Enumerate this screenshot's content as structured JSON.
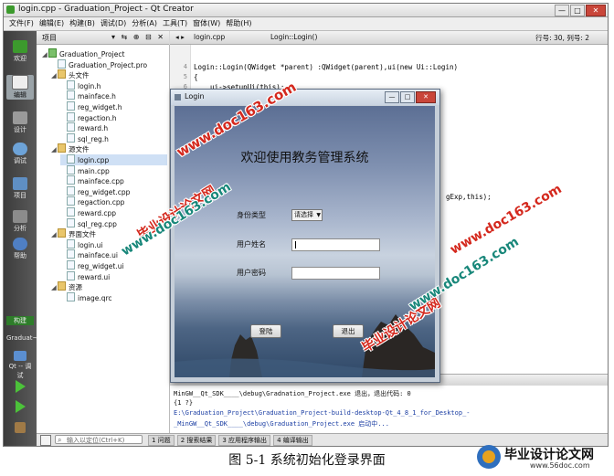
{
  "window": {
    "title": "login.cpp - Graduation_Project - Qt Creator",
    "buttons": [
      "—",
      "□",
      "✕"
    ]
  },
  "menu": [
    "文件(F)",
    "编辑(E)",
    "构建(B)",
    "调试(D)",
    "分析(A)",
    "工具(T)",
    "窗体(W)",
    "帮助(H)"
  ],
  "modes": [
    {
      "label": "欢迎"
    },
    {
      "label": "编辑"
    },
    {
      "label": "设计"
    },
    {
      "label": "调试"
    },
    {
      "label": "项目"
    },
    {
      "label": "分析"
    },
    {
      "label": "帮助"
    }
  ],
  "target": {
    "label": "构建",
    "project": "Graduat~roject",
    "kit": "Qt -- 调试"
  },
  "projects_panel": {
    "label": "项目",
    "tools": "▾ ⇆ ⊕ ⊟ ✕",
    "items": [
      {
        "text": "Graduation_Project",
        "kind": "proj",
        "level": 0,
        "expanded": true
      },
      {
        "text": "Graduation_Project.pro",
        "kind": "file",
        "level": 1
      },
      {
        "text": "头文件",
        "kind": "folder",
        "level": 1,
        "expanded": true
      },
      {
        "text": "login.h",
        "kind": "file",
        "level": 2
      },
      {
        "text": "mainface.h",
        "kind": "file",
        "level": 2
      },
      {
        "text": "reg_widget.h",
        "kind": "file",
        "level": 2
      },
      {
        "text": "regaction.h",
        "kind": "file",
        "level": 2
      },
      {
        "text": "reward.h",
        "kind": "file",
        "level": 2
      },
      {
        "text": "sql_reg.h",
        "kind": "file",
        "level": 2
      },
      {
        "text": "源文件",
        "kind": "folder",
        "level": 1,
        "expanded": true
      },
      {
        "text": "login.cpp",
        "kind": "file",
        "level": 2,
        "selected": true
      },
      {
        "text": "main.cpp",
        "kind": "file",
        "level": 2
      },
      {
        "text": "mainface.cpp",
        "kind": "file",
        "level": 2
      },
      {
        "text": "reg_widget.cpp",
        "kind": "file",
        "level": 2
      },
      {
        "text": "regaction.cpp",
        "kind": "file",
        "level": 2
      },
      {
        "text": "reward.cpp",
        "kind": "file",
        "level": 2
      },
      {
        "text": "sql_reg.cpp",
        "kind": "file",
        "level": 2
      },
      {
        "text": "界面文件",
        "kind": "folder",
        "level": 1,
        "expanded": true
      },
      {
        "text": "login.ui",
        "kind": "file",
        "level": 2
      },
      {
        "text": "mainface.ui",
        "kind": "file",
        "level": 2
      },
      {
        "text": "reg_widget.ui",
        "kind": "file",
        "level": 2
      },
      {
        "text": "reward.ui",
        "kind": "file",
        "level": 2
      },
      {
        "text": "资源",
        "kind": "folder",
        "level": 1,
        "expanded": true
      },
      {
        "text": "image.qrc",
        "kind": "file",
        "level": 2
      }
    ]
  },
  "editor": {
    "tab_file": "login.cpp",
    "tab_symbol": "Login::Login()",
    "position": "行号: 30, 列号: 2",
    "lines": [
      {
        "n": "4",
        "code": "Login::Login(QWidget *parent) :QWidget(parent),ui(new Ui::Login)"
      },
      {
        "n": "5",
        "code": "{"
      },
      {
        "n": "6",
        "code": "    ui->setupUi(this);"
      },
      {
        "n": "7",
        "code": "    ui->"
      },
      {
        "n": "",
        "code": "gExp,this);"
      }
    ]
  },
  "output": {
    "lines": [
      {
        "text": "MinGW__Qt_SDK____\\debug\\Gradnation_Project.exe 退出，退出代码: 0",
        "style": "normal"
      },
      {
        "text": "{1 ?}",
        "style": "normal"
      },
      {
        "text": "E:\\Graduation_Project\\Graduation_Project-build-desktop-Qt_4_8_1_for_Desktop_-",
        "style": "blue"
      },
      {
        "text": "_MinGW__Qt_SDK____\\debug\\Graduation_Project.exe 启动中...",
        "style": "blue"
      }
    ]
  },
  "statusbar": {
    "locator_placeholder": "输入以定位(Ctrl+K)",
    "tabs": [
      "1 问题",
      "2 搜索结果",
      "3 应用程序输出",
      "4 编译输出"
    ]
  },
  "login_dialog": {
    "title": "Login",
    "heading": "欢迎使用教务管理系统",
    "identity_label": "身份类型",
    "identity_value": "请选择",
    "username_label": "用户姓名",
    "password_label": "用户密码",
    "login_button": "登陆",
    "exit_button": "退出"
  },
  "watermarks": {
    "site": "www.doc163.com",
    "brand": "毕业设计论文网"
  },
  "caption": "图 5-1 系统初始化登录界面",
  "logo": {
    "name": "毕业设计论文网",
    "url": "www.56doc.com"
  },
  "colors": {
    "accent_green": "#3c9a2d",
    "watermark_red": "#d4281d",
    "watermark_teal": "#18877a"
  }
}
